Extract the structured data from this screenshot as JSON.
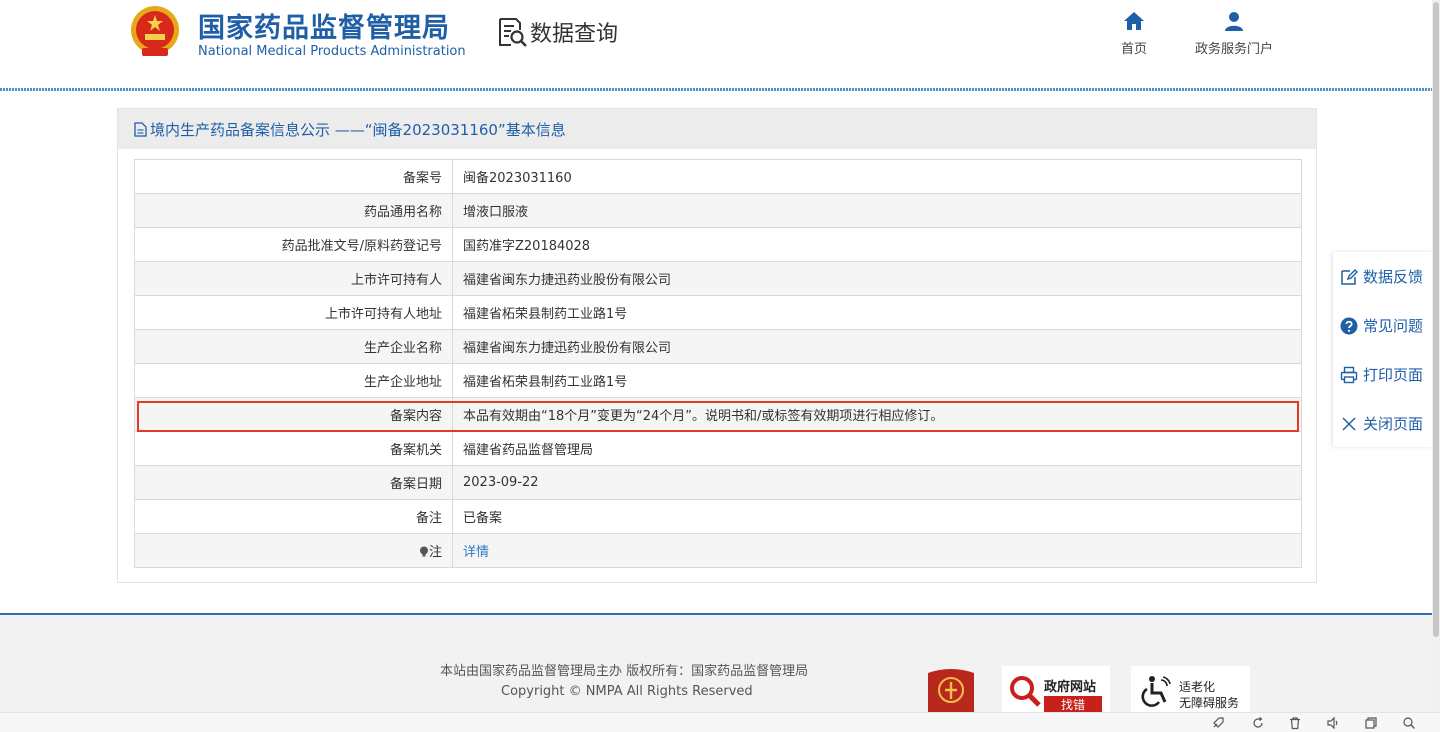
{
  "header": {
    "brand_cn": "国家药品监督管理局",
    "brand_en": "National Medical Products Administration",
    "query_label": "数据查询",
    "nav": [
      {
        "label": "首页",
        "icon": "home-icon"
      },
      {
        "label": "政务服务门户",
        "icon": "user-icon"
      }
    ]
  },
  "panel": {
    "title": "境内生产药品备案信息公示 ——“闽备2023031160”基本信息",
    "rows": [
      {
        "key": "备案号",
        "value": "闽备2023031160"
      },
      {
        "key": "药品通用名称",
        "value": "增液口服液"
      },
      {
        "key": "药品批准文号/原料药登记号",
        "value": "国药准字Z20184028"
      },
      {
        "key": "上市许可持有人",
        "value": "福建省闽东力捷迅药业股份有限公司"
      },
      {
        "key": "上市许可持有人地址",
        "value": "福建省柘荣县制药工业路1号"
      },
      {
        "key": "生产企业名称",
        "value": "福建省闽东力捷迅药业股份有限公司"
      },
      {
        "key": "生产企业地址",
        "value": "福建省柘荣县制药工业路1号"
      },
      {
        "key": "备案内容",
        "value": "本品有效期由“18个月”变更为“24个月”。说明书和/或标签有效期项进行相应修订。"
      },
      {
        "key": "备案机关",
        "value": "福建省药品监督管理局"
      },
      {
        "key": "备案日期",
        "value": "2023-09-22"
      },
      {
        "key": "备注",
        "value": "已备案"
      },
      {
        "key": "注",
        "value": "详情"
      }
    ]
  },
  "side": [
    {
      "label": "数据反馈",
      "icon": "edit-icon"
    },
    {
      "label": "常见问题",
      "icon": "question-icon"
    },
    {
      "label": "打印页面",
      "icon": "print-icon"
    },
    {
      "label": "关闭页面",
      "icon": "close-icon"
    }
  ],
  "footer": {
    "line1": "本站由国家药品监督管理局主办 版权所有：国家药品监督管理局",
    "line2": "Copyright © NMPA All Rights Reserved",
    "badge_gov_top": "政府网站",
    "badge_gov_bottom": "找错",
    "badge_age_top": "适老化",
    "badge_age_bottom": "无障碍服务"
  },
  "colors": {
    "brand": "#1f5fa8",
    "highlight": "#e23b1f",
    "link": "#2a7bc4"
  }
}
